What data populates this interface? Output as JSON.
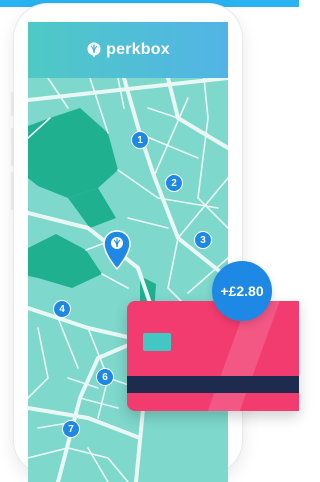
{
  "app": {
    "brand": "perkbox"
  },
  "map": {
    "markers": [
      {
        "label": "1"
      },
      {
        "label": "2"
      },
      {
        "label": "3"
      },
      {
        "label": "4"
      },
      {
        "label": "6"
      },
      {
        "label": "7"
      }
    ]
  },
  "reward": {
    "amount": "+£2.80"
  },
  "colors": {
    "header_start": "#4fc9c6",
    "header_end": "#52b4e6",
    "map_base": "#7ed8cc",
    "park": "#1fb08f",
    "road": "#eaf8f5",
    "marker": "#1e88e5",
    "card": "#f23c70",
    "card_stripe": "#1f2a4f",
    "card_chip": "#42c7c3"
  }
}
